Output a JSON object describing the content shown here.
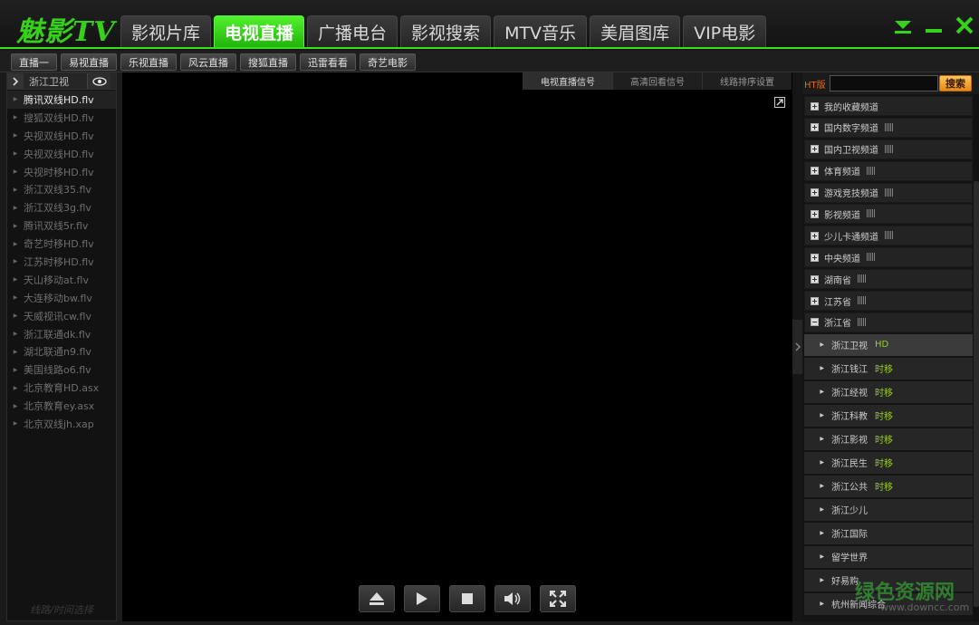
{
  "app": {
    "logo": "魅影TV",
    "accent": "#3ddc1c"
  },
  "main_tabs": [
    {
      "label": "影视片库",
      "active": false
    },
    {
      "label": "电视直播",
      "active": true
    },
    {
      "label": "广播电台",
      "active": false
    },
    {
      "label": "影视搜索",
      "active": false
    },
    {
      "label": "MTV音乐",
      "active": false
    },
    {
      "label": "美眉图库",
      "active": false
    },
    {
      "label": "VIP电影",
      "active": false
    }
  ],
  "window_controls": [
    "dropdown-icon",
    "minimize-icon",
    "close-icon"
  ],
  "sub_tabs": [
    "直播一",
    "易视直播",
    "乐视直播",
    "风云直播",
    "搜狐直播",
    "迅雷看看",
    "奇艺电影"
  ],
  "left_panel": {
    "current_channel": "浙江卫视",
    "sources": [
      {
        "label": "腾讯双线HD.flv",
        "active": true
      },
      {
        "label": "搜狐双线HD.flv",
        "active": false
      },
      {
        "label": "央视双线HD.flv",
        "active": false
      },
      {
        "label": "央视双线HD.flv",
        "active": false
      },
      {
        "label": "央视时移HD.flv",
        "active": false
      },
      {
        "label": "浙江双线35.flv",
        "active": false
      },
      {
        "label": "浙江双线3g.flv",
        "active": false
      },
      {
        "label": "腾讯双线5r.flv",
        "active": false
      },
      {
        "label": "奇艺时移HD.flv",
        "active": false
      },
      {
        "label": "江苏时移HD.flv",
        "active": false
      },
      {
        "label": "天山移动at.flv",
        "active": false
      },
      {
        "label": "大连移动bw.flv",
        "active": false
      },
      {
        "label": "天威视讯cw.flv",
        "active": false
      },
      {
        "label": "浙江联通dk.flv",
        "active": false
      },
      {
        "label": "湖北联通n9.flv",
        "active": false
      },
      {
        "label": "美国线路o6.flv",
        "active": false
      },
      {
        "label": "北京教育HD.asx",
        "active": false
      },
      {
        "label": "北京教育ey.asx",
        "active": false
      },
      {
        "label": "北京双线jh.xap",
        "active": false
      }
    ],
    "footer": "线路/时间选择"
  },
  "video": {
    "tabs": [
      {
        "label": "电视直播信号",
        "active": true
      },
      {
        "label": "高清回看信号",
        "active": false
      },
      {
        "label": "线路排序设置",
        "active": false
      }
    ],
    "controls": [
      "eject-icon",
      "play-icon",
      "stop-icon",
      "volume-icon",
      "fullscreen-icon"
    ]
  },
  "right_panel": {
    "search_label": "HT版",
    "search_placeholder": "",
    "search_button": "搜索",
    "categories": [
      {
        "label": "我的收藏频道",
        "expanded": false,
        "signal": ""
      },
      {
        "label": "国内数字频道",
        "expanded": false,
        "signal": "|||||"
      },
      {
        "label": "国内卫视频道",
        "expanded": false,
        "signal": "|||||"
      },
      {
        "label": "体育频道",
        "expanded": false,
        "signal": "|||||"
      },
      {
        "label": "游戏竞技频道",
        "expanded": false,
        "signal": "|||||"
      },
      {
        "label": "影视频道",
        "expanded": false,
        "signal": "|||||"
      },
      {
        "label": "少儿卡通频道",
        "expanded": false,
        "signal": "|||||"
      },
      {
        "label": "中央频道",
        "expanded": false,
        "signal": "|||||"
      },
      {
        "label": "湖南省",
        "expanded": false,
        "signal": "|||||"
      },
      {
        "label": "江苏省",
        "expanded": false,
        "signal": "|||||"
      },
      {
        "label": "浙江省",
        "expanded": true,
        "signal": "|||||"
      }
    ],
    "channels": [
      {
        "label": "浙江卫视",
        "tag": "HD",
        "selected": true
      },
      {
        "label": "浙江钱江",
        "tag": "时移",
        "selected": false
      },
      {
        "label": "浙江经视",
        "tag": "时移",
        "selected": false
      },
      {
        "label": "浙江科教",
        "tag": "时移",
        "selected": false
      },
      {
        "label": "浙江影视",
        "tag": "时移",
        "selected": false
      },
      {
        "label": "浙江民生",
        "tag": "时移",
        "selected": false
      },
      {
        "label": "浙江公共",
        "tag": "时移",
        "selected": false
      },
      {
        "label": "浙江少儿",
        "tag": "",
        "selected": false
      },
      {
        "label": "浙江国际",
        "tag": "",
        "selected": false
      },
      {
        "label": "留学世界",
        "tag": "",
        "selected": false
      },
      {
        "label": "好易购",
        "tag": "",
        "selected": false
      },
      {
        "label": "杭州新闻综合",
        "tag": "",
        "selected": false
      }
    ]
  },
  "watermark": {
    "text": "绿色资源网",
    "url": "www.downcc.com"
  }
}
